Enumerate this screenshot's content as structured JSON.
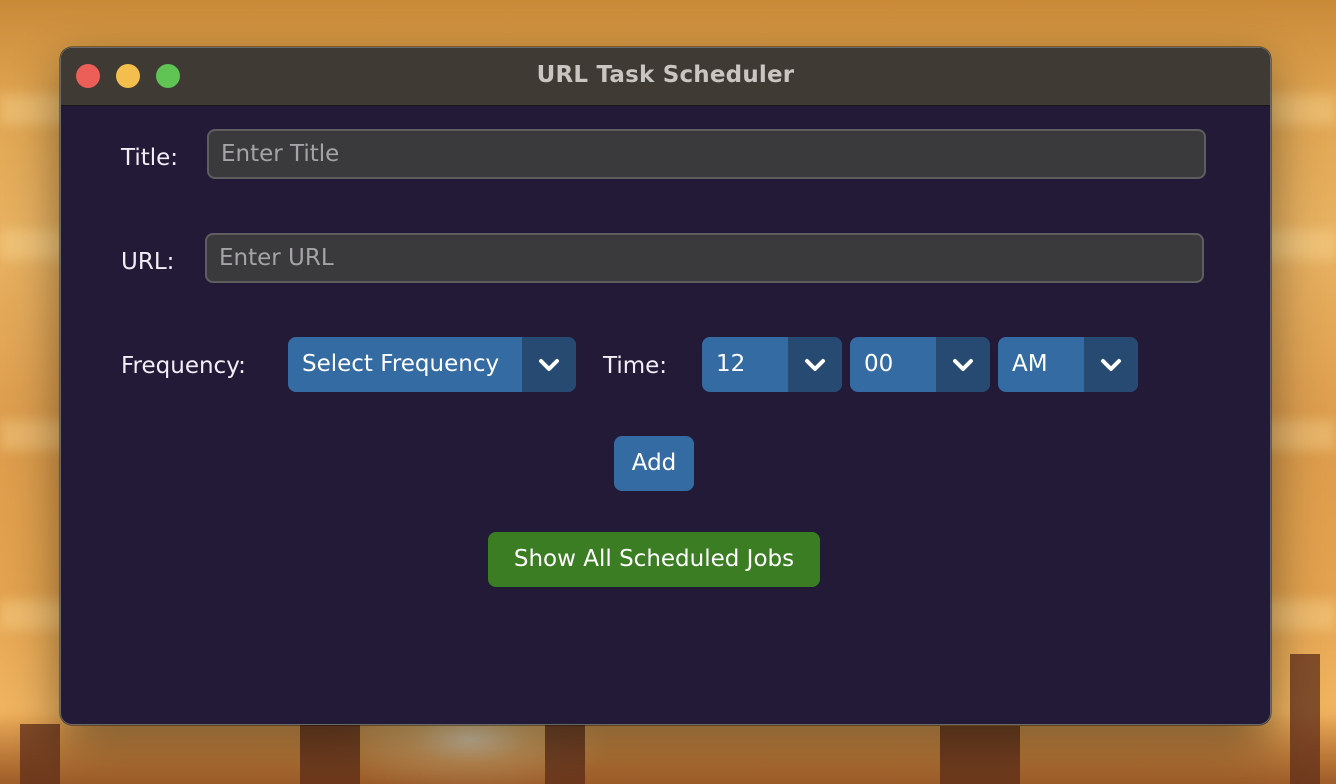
{
  "window": {
    "title": "URL Task Scheduler"
  },
  "form": {
    "title_label": "Title:",
    "title_placeholder": "Enter Title",
    "title_value": "",
    "url_label": "URL:",
    "url_placeholder": "Enter URL",
    "url_value": "",
    "frequency_label": "Frequency:",
    "frequency_selected": "Select Frequency",
    "time_label": "Time:",
    "hour_selected": "12",
    "minute_selected": "00",
    "ampm_selected": "AM"
  },
  "actions": {
    "add_label": "Add",
    "show_jobs_label": "Show All Scheduled Jobs"
  },
  "colors": {
    "window_bg": "#231a37",
    "dropdown": "#356ba3",
    "dropdown_arrow": "#274a73",
    "add_button": "#356ba3",
    "show_button": "#3a7d22"
  },
  "icons": {
    "dropdown": "chevron-down-icon"
  }
}
